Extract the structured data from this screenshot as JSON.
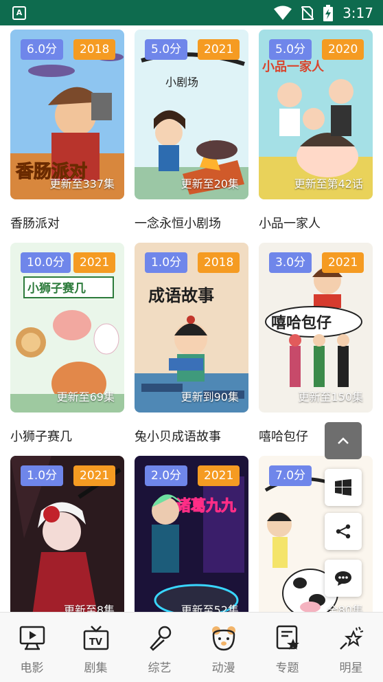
{
  "status_bar": {
    "time": "3:17",
    "app_icon_letter": "A"
  },
  "cards": [
    {
      "score": "6.0分",
      "year": "2018",
      "update": "更新至337集",
      "title": "香肠派对",
      "art": "sausage-party"
    },
    {
      "score": "5.0分",
      "year": "2021",
      "update": "更新至20集",
      "title": "一念永恒小剧场",
      "art": "yinian"
    },
    {
      "score": "5.0分",
      "year": "2020",
      "update": "更新至第42话",
      "title": "小品一家人",
      "art": "xiaopin"
    },
    {
      "score": "10.0分",
      "year": "2021",
      "update": "更新至69集",
      "title": "小狮子赛几",
      "art": "lion"
    },
    {
      "score": "1.0分",
      "year": "2018",
      "update": "更新到90集",
      "title": "兔小贝成语故事",
      "art": "tuxiaobei"
    },
    {
      "score": "3.0分",
      "year": "2021",
      "update": "更新至150集",
      "title": "嘻哈包仔",
      "art": "xiha"
    },
    {
      "score": "1.0分",
      "year": "2021",
      "update": "更新至8集",
      "title": "",
      "art": "red-girl"
    },
    {
      "score": "2.0分",
      "year": "2021",
      "update": "更新至52集",
      "title": "",
      "art": "cyber"
    },
    {
      "score": "7.0分",
      "year": "",
      "update": "全80集",
      "title": "",
      "art": "cow"
    }
  ],
  "poster_texts": {
    "sausage": "香肠派对",
    "yinian": "小剧场",
    "xiaopin": "小品一家人",
    "lion": "小狮子赛几",
    "tuxiaobei": "成语故事",
    "xiha": "嘻哈包仔",
    "cyber": "诸葛九九"
  },
  "fabs": [
    {
      "name": "scroll-top-button",
      "icon": "chevron-up-icon"
    },
    {
      "name": "windows-button",
      "icon": "windows-icon"
    },
    {
      "name": "share-button",
      "icon": "share-icon"
    },
    {
      "name": "chat-button",
      "icon": "chat-icon"
    }
  ],
  "tabs": [
    {
      "label": "电影",
      "icon": "movie-screen-icon"
    },
    {
      "label": "剧集",
      "icon": "tv-icon"
    },
    {
      "label": "综艺",
      "icon": "microphone-icon"
    },
    {
      "label": "动漫",
      "icon": "bear-face-icon"
    },
    {
      "label": "专题",
      "icon": "topic-icon"
    },
    {
      "label": "明星",
      "icon": "star-sparkle-icon"
    }
  ],
  "colors": {
    "status_bar": "#0e6b4e",
    "score_badge": "#6f86ea",
    "year_badge": "#f59b22",
    "tab_icon": "#222222",
    "tab_label": "#777777"
  }
}
